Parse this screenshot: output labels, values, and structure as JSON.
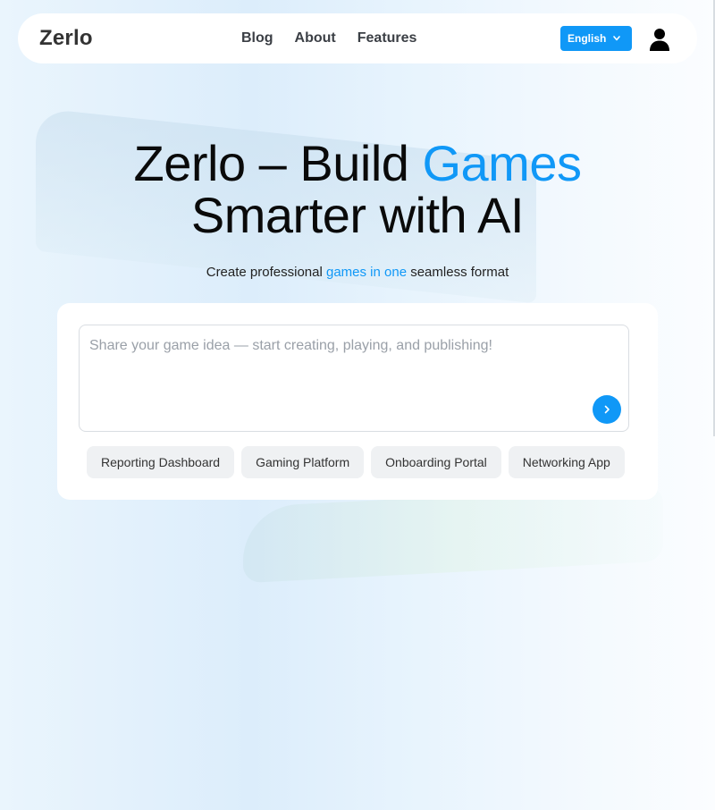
{
  "nav": {
    "logo": "Zerlo",
    "links": [
      {
        "label": "Blog"
      },
      {
        "label": "About"
      },
      {
        "label": "Features"
      }
    ],
    "language": "English",
    "icons": {
      "language_chevron": "chevron-down-icon",
      "account": "user-icon"
    }
  },
  "hero": {
    "title_part1": "Zerlo – Build ",
    "title_accent": "Games",
    "title_part2": "Smarter with AI",
    "subtitle_before": "Create professional ",
    "subtitle_accent": "games in one",
    "subtitle_after": " seamless format"
  },
  "prompt": {
    "placeholder": "Share your game idea — start creating, playing, and publishing!",
    "value": "",
    "send_icon": "chevron-right-icon"
  },
  "suggestions": [
    {
      "label": "Reporting Dashboard"
    },
    {
      "label": "Gaming Platform"
    },
    {
      "label": "Onboarding Portal"
    },
    {
      "label": "Networking App"
    }
  ],
  "colors": {
    "accent": "#1098f7",
    "chip_bg": "#eff1f3",
    "text_dark": "#0a0a0a"
  }
}
